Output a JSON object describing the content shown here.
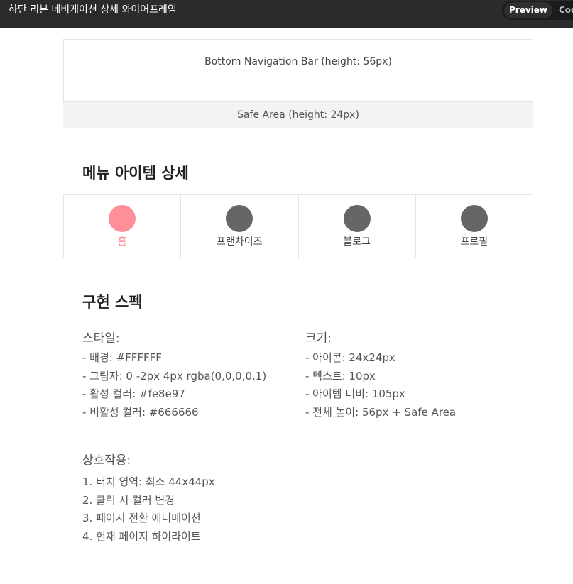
{
  "window": {
    "title": "하단 리본 네비게이션 상세 와이어프레임",
    "tab_preview": "Preview",
    "tab_code": "Code"
  },
  "wireframe": {
    "nav_label": "Bottom Navigation Bar (height: 56px)",
    "safe_label": "Safe Area (height: 24px)"
  },
  "menu_section": {
    "title": "메뉴 아이템 상세",
    "items": [
      {
        "label": "홈",
        "active": true
      },
      {
        "label": "프랜차이즈",
        "active": false
      },
      {
        "label": "블로그",
        "active": false
      },
      {
        "label": "프로필",
        "active": false
      }
    ]
  },
  "spec_section": {
    "title": "구현 스펙",
    "style": {
      "heading": "스타일:",
      "lines": [
        "- 배경: #FFFFFF",
        "- 그림자: 0 -2px 4px rgba(0,0,0,0.1)",
        "- 활성 컬러: #fe8e97",
        "- 비활성 컬러: #666666"
      ]
    },
    "size": {
      "heading": "크기:",
      "lines": [
        "- 아이콘: 24x24px",
        "- 텍스트: 10px",
        "- 아이템 너비: 105px",
        "- 전체 높이: 56px + Safe Area"
      ]
    },
    "interaction": {
      "heading": "상호작용:",
      "lines": [
        "1. 터치 영역: 최소 44x44px",
        "2. 클릭 시 컬러 변경",
        "3. 페이지 전환 애니메이션",
        "4. 현재 페이지 하이라이트"
      ]
    }
  },
  "colors": {
    "active": "#fe8e97",
    "inactive": "#666666",
    "topbar": "#2b2b2b"
  }
}
